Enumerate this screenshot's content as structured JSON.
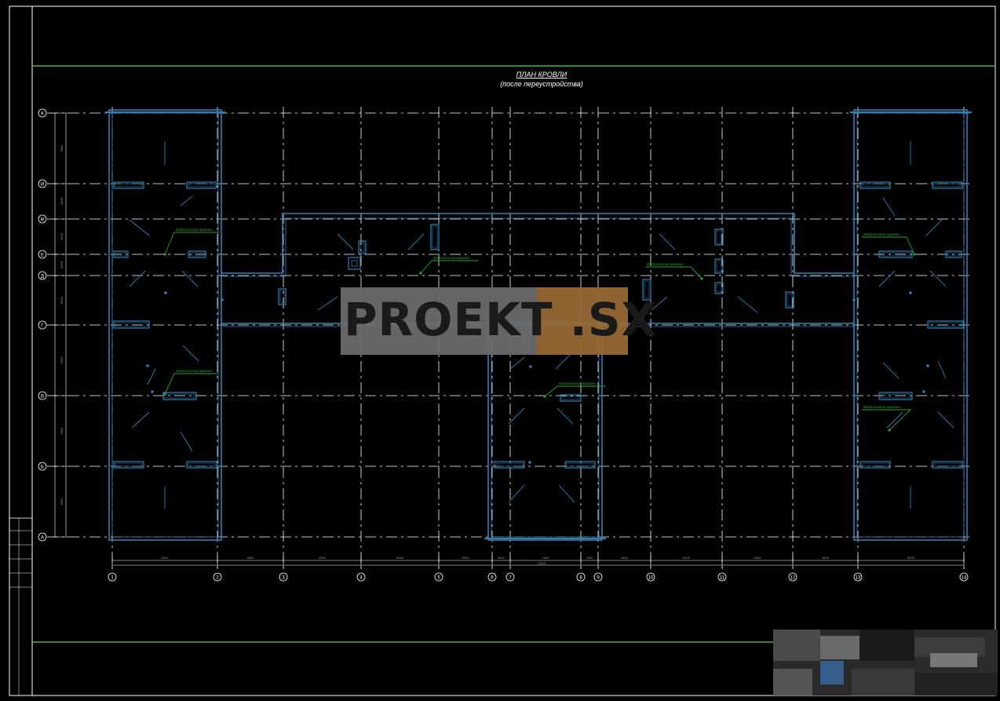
{
  "sheet": {
    "title": "ПЛАН КРОВЛИ",
    "subtitle": "(после переустройства)"
  },
  "watermark": {
    "text": "PROEKT .SX"
  },
  "axes": {
    "rows": [
      "К",
      "И",
      "Ж",
      "Е",
      "Д",
      "Г",
      "В",
      "Б",
      "А"
    ],
    "columns": [
      "1",
      "2",
      "3",
      "4",
      "5",
      "6",
      "7",
      "8",
      "9",
      "10",
      "11",
      "12",
      "13",
      "14"
    ]
  },
  "dimensions": {
    "bottom_segments": [
      "6000",
      "4500",
      "4500",
      "6000",
      "6000",
      "4500",
      "1500",
      "1500",
      "4500",
      "6000",
      "6000",
      "4500",
      "6000"
    ],
    "bottom_overall": "72000",
    "left_segments": [
      "6000",
      "3000",
      "3000",
      "3000",
      "6000",
      "6000",
      "6000",
      "6000"
    ]
  },
  "callouts": {
    "label": "Водосточная воронка"
  },
  "colors": {
    "background": "#000000",
    "frame": "#ffffff",
    "grid": "#ffffff",
    "walls": "#2f7fb4",
    "border_accent": "#3fb43f",
    "callout": "#29a529"
  }
}
